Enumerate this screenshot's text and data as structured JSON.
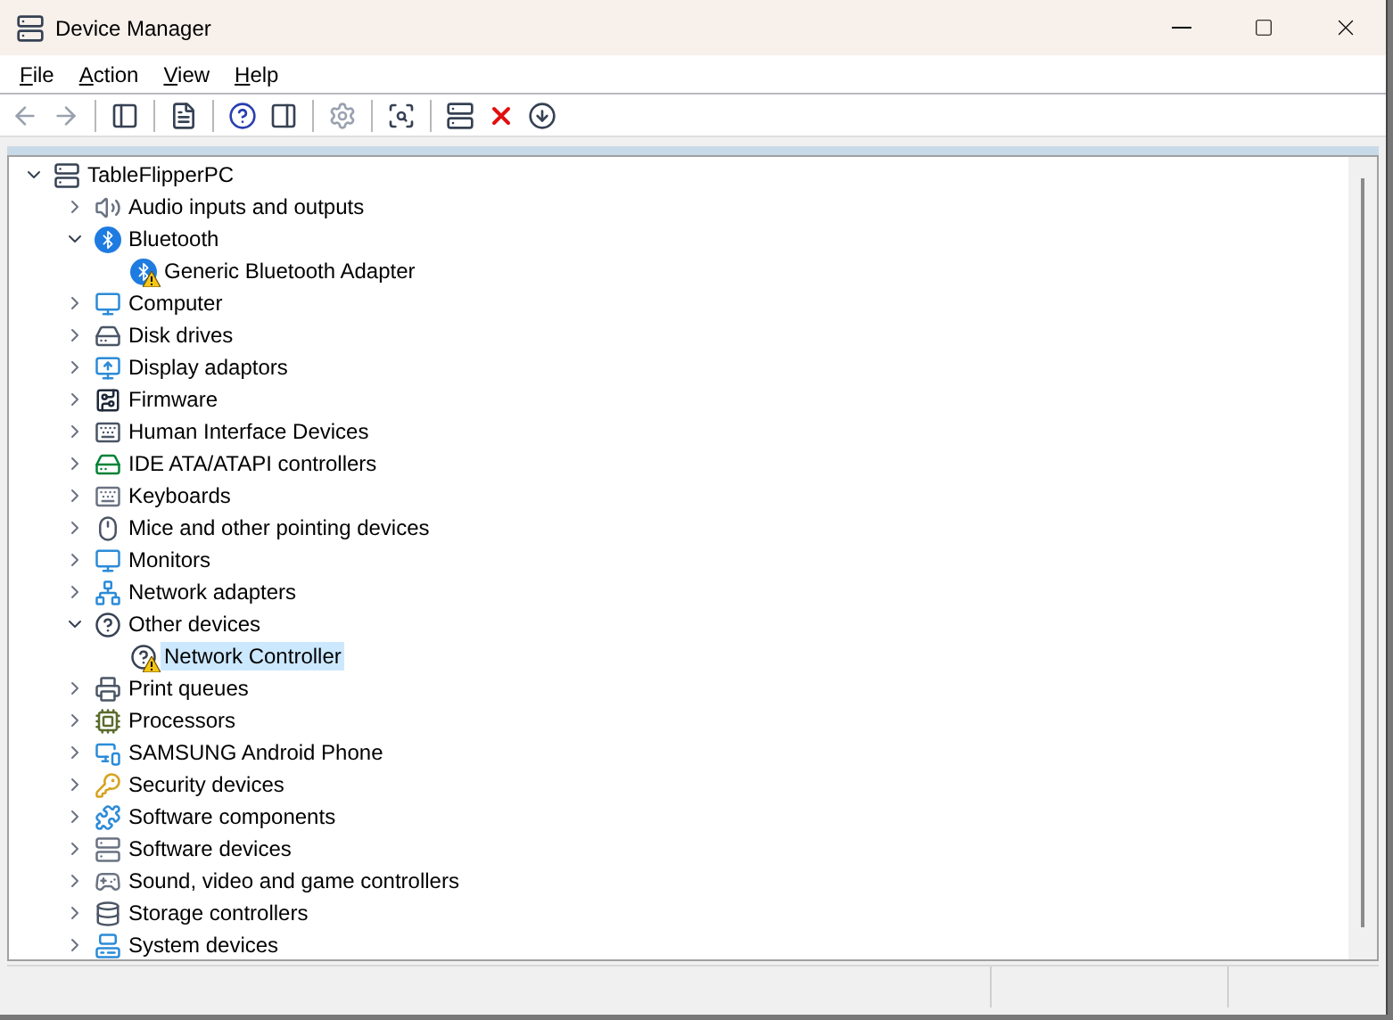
{
  "window": {
    "title": "Device Manager"
  },
  "menu": [
    {
      "label": "File"
    },
    {
      "label": "Action"
    },
    {
      "label": "View"
    },
    {
      "label": "Help"
    }
  ],
  "toolbar": [
    {
      "kind": "back",
      "disabled": true
    },
    {
      "kind": "forward",
      "disabled": true
    },
    {
      "kind": "separator"
    },
    {
      "kind": "tree",
      "disabled": false
    },
    {
      "kind": "separator"
    },
    {
      "kind": "properties",
      "disabled": false
    },
    {
      "kind": "separator"
    },
    {
      "kind": "help",
      "disabled": false
    },
    {
      "kind": "pane",
      "disabled": false
    },
    {
      "kind": "separator"
    },
    {
      "kind": "update",
      "disabled": true
    },
    {
      "kind": "separator"
    },
    {
      "kind": "scan",
      "disabled": false
    },
    {
      "kind": "separator"
    },
    {
      "kind": "add",
      "disabled": false
    },
    {
      "kind": "remove",
      "disabled": false
    },
    {
      "kind": "download",
      "disabled": false
    }
  ],
  "tree": {
    "label": "TableFlipperPC",
    "expanded": true,
    "selected": false,
    "children": [
      {
        "label": "Audio inputs and outputs",
        "expanded": false,
        "selected": false
      },
      {
        "label": "Bluetooth",
        "expanded": true,
        "selected": false,
        "children": [
          {
            "label": "Generic Bluetooth Adapter",
            "warning": true,
            "selected": false
          }
        ]
      },
      {
        "label": "Computer",
        "expanded": false,
        "selected": false
      },
      {
        "label": "Disk drives",
        "expanded": false,
        "selected": false
      },
      {
        "label": "Display adaptors",
        "expanded": false,
        "selected": false
      },
      {
        "label": "Firmware",
        "expanded": false,
        "selected": false
      },
      {
        "label": "Human Interface Devices",
        "expanded": false,
        "selected": false
      },
      {
        "label": "IDE ATA/ATAPI controllers",
        "expanded": false,
        "selected": false
      },
      {
        "label": "Keyboards",
        "expanded": false,
        "selected": false
      },
      {
        "label": "Mice and other pointing devices",
        "expanded": false,
        "selected": false
      },
      {
        "label": "Monitors",
        "expanded": false,
        "selected": false
      },
      {
        "label": "Network adapters",
        "expanded": false,
        "selected": false
      },
      {
        "label": "Other devices",
        "expanded": true,
        "selected": false,
        "children": [
          {
            "label": "Network Controller",
            "warning": true,
            "selected": true
          }
        ]
      },
      {
        "label": "Print queues",
        "expanded": false,
        "selected": false
      },
      {
        "label": "Processors",
        "expanded": false,
        "selected": false
      },
      {
        "label": "SAMSUNG Android Phone",
        "expanded": false,
        "selected": false
      },
      {
        "label": "Security devices",
        "expanded": false,
        "selected": false
      },
      {
        "label": "Software components",
        "expanded": false,
        "selected": false
      },
      {
        "label": "Software devices",
        "expanded": false,
        "selected": false
      },
      {
        "label": "Sound, video and game controllers",
        "expanded": false,
        "selected": false
      },
      {
        "label": "Storage controllers",
        "expanded": false,
        "selected": false
      },
      {
        "label": "System devices",
        "expanded": false,
        "selected": false
      }
    ]
  }
}
